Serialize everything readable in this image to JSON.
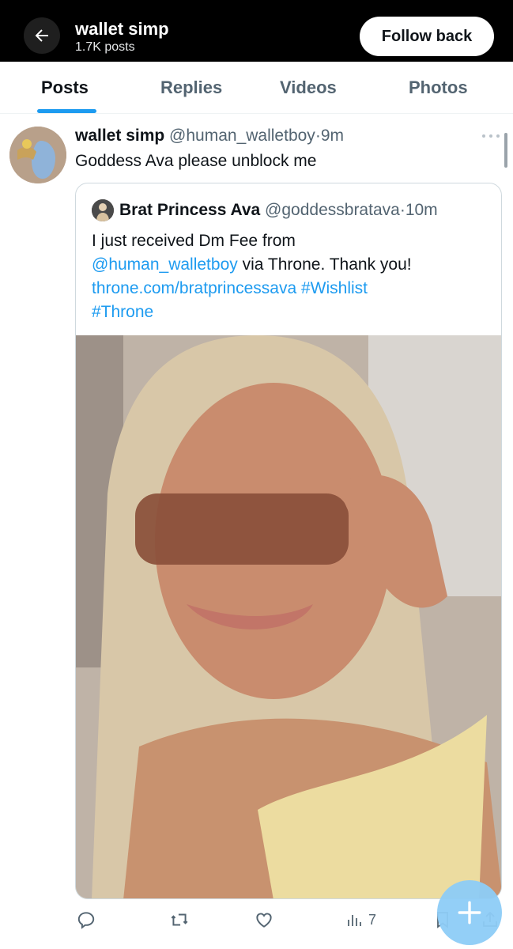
{
  "header": {
    "title": "wallet simp",
    "subtitle": "1.7K posts",
    "follow_label": "Follow back"
  },
  "tabs": [
    {
      "label": "Posts",
      "active": true
    },
    {
      "label": "Replies",
      "active": false
    },
    {
      "label": "Videos",
      "active": false
    },
    {
      "label": "Photos",
      "active": false
    }
  ],
  "tweet": {
    "name": "wallet simp",
    "handle": "@human_walletboy",
    "time": "9m",
    "separator": "·",
    "text": "Goddess Ava please unblock me",
    "quote": {
      "name": "Brat Princess Ava",
      "handle": "@goddessbratava",
      "time": "10m",
      "line1": "I just received Dm Fee from",
      "mention": "@human_walletboy",
      "line2_rest": " via Throne. Thank you!",
      "link": "throne.com/bratprincessava",
      "hashtag1": "#Wishlist",
      "hashtag2": "#Throne"
    },
    "views": "7"
  },
  "colors": {
    "accent": "#1d9bf0",
    "header_bg": "#000000",
    "muted": "#536471"
  },
  "icons": {
    "back": "arrow-left-icon",
    "more": "more-dots-icon",
    "reply": "reply-icon",
    "repost": "repost-icon",
    "like": "like-icon",
    "views": "views-icon",
    "bookmark": "bookmark-icon",
    "share": "share-icon",
    "compose": "compose-plus-icon"
  }
}
